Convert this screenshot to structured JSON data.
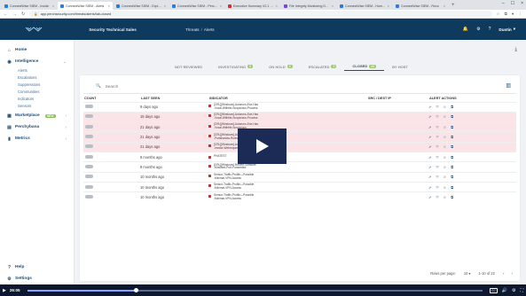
{
  "browser": {
    "tabs": [
      {
        "label": "ConnectWise SIEM - Incide",
        "icon": "shield-favicon",
        "active": false
      },
      {
        "label": "ConnectWise SIEM - Alerts",
        "icon": "shield-favicon",
        "active": true
      },
      {
        "label": "ConnectWise SIEM - Explore",
        "icon": "shield-favicon",
        "active": false
      },
      {
        "label": "ConnectWise SIEM - Perchybana",
        "icon": "shield-favicon",
        "active": false
      },
      {
        "label": "Executive Summary V2.1 - Host",
        "icon": "cw-favicon",
        "active": false
      },
      {
        "label": "File Integrity Monitoring Dash",
        "icon": "cw-favicon",
        "active": false
      },
      {
        "label": "ConnectWise SIEM - Home Dash",
        "icon": "shield-favicon",
        "active": false
      },
      {
        "label": "ConnectWise SIEM - Reco",
        "icon": "shield-favicon",
        "active": false
      }
    ],
    "url": "app.perchsecurity.com/threats/alerts/tab-closed",
    "new_tab": "+"
  },
  "appbar": {
    "org_name": "Security Technical Sales",
    "breadcrumb_parent": "Threats",
    "breadcrumb_sep": "/",
    "breadcrumb_current": "Alerts",
    "user_name": "Dustin"
  },
  "sidebar": {
    "items": [
      {
        "label": "Home",
        "icon": "home-icon"
      },
      {
        "label": "Intelligence",
        "icon": "intelligence-icon"
      },
      {
        "label": "Marketplace",
        "icon": "marketplace-icon",
        "badge": "NEW"
      },
      {
        "label": "Perchybana",
        "icon": "perchybana-icon"
      },
      {
        "label": "Metrics",
        "icon": "metrics-icon"
      }
    ],
    "intelligence_sub": [
      "Alerts",
      "Escalations",
      "Suppressions",
      "Communities",
      "Indicators",
      "Sensors"
    ],
    "bottom": [
      {
        "label": "Help",
        "icon": "help-icon"
      },
      {
        "label": "Settings",
        "icon": "settings-icon"
      }
    ]
  },
  "filter_tabs": [
    {
      "label": "NOT REVIEWED",
      "count": ""
    },
    {
      "label": "INVESTIGATING",
      "count": "0"
    },
    {
      "label": "ON HOLD",
      "count": "0"
    },
    {
      "label": "ESCALATED",
      "count": "0"
    },
    {
      "label": "CLOSED",
      "count": "22"
    },
    {
      "label": "BY HOST",
      "count": ""
    }
  ],
  "search": {
    "placeholder": "Search"
  },
  "table": {
    "headers": [
      "COUNT",
      "LAST SEEN",
      "INDICATOR",
      "SRC / DEST IP",
      "ALERT ACTIONS"
    ],
    "rows": [
      {
        "last_seen": "9 days ago",
        "indicator": [
          "[CRL][Windows]-Autoruns-Exe-Has",
          "-Vocal-Withfile-Suspicious-Process"
        ],
        "highlight": false
      },
      {
        "last_seen": "15 days ago",
        "indicator": [
          "[CRL][Windows]-Autoruns-Exe-Has",
          "-Vocal-Withfile-Suspicious-Process"
        ],
        "highlight": true
      },
      {
        "last_seen": "21 days ago",
        "indicator": [
          "[CRL][Windows]-Autoruns-Exe-Has",
          "-Vocal-Withfile-Suspicious"
        ],
        "highlight": true
      },
      {
        "last_seen": "21 days ago",
        "indicator": [
          "[CRL][Windows]-Autoruns-Exe-Has",
          "-Portshadow-Rules"
        ],
        "highlight": true
      },
      {
        "last_seen": "21 days ago",
        "indicator": [
          "[CRL][Windows]-Autoruns-Exe-Has",
          "-Invoke-Webrequest-Executed-Parameters"
        ],
        "highlight": true
      },
      {
        "last_seen": "9 months ago",
        "indicator": [
          "PHATEST",
          ""
        ],
        "highlight": false
      },
      {
        "last_seen": "9 months ago",
        "indicator": [
          "[CRL][Windows]-Recent-Software",
          "-Modified-Port-Forwarded"
        ],
        "highlight": false
      },
      {
        "last_seen": "10 months ago",
        "indicator": [
          "Sensor-Traffic-Profile—Possible",
          "-Minimal-VPN-Access"
        ],
        "highlight": false
      },
      {
        "last_seen": "10 months ago",
        "indicator": [
          "Sensor-Traffic-Profile—Possible",
          "-Minimal-VPN-Access"
        ],
        "highlight": false
      },
      {
        "last_seen": "10 months ago",
        "indicator": [
          "Sensor-Traffic-Profile—Possible",
          "-Minimal-VPN-Access"
        ],
        "highlight": false
      }
    ]
  },
  "pager": {
    "rows_label": "Rows per page:",
    "rows_value": "10",
    "range": "1-10 of 22"
  },
  "video": {
    "time": "26:05",
    "progress": 0.24,
    "cc": "CC"
  },
  "colors": {
    "appbar": "#0e3a5e",
    "accent": "#1d4f7b",
    "row_highlight": "#fbe4e7",
    "badge_green": "#9ec86d"
  }
}
